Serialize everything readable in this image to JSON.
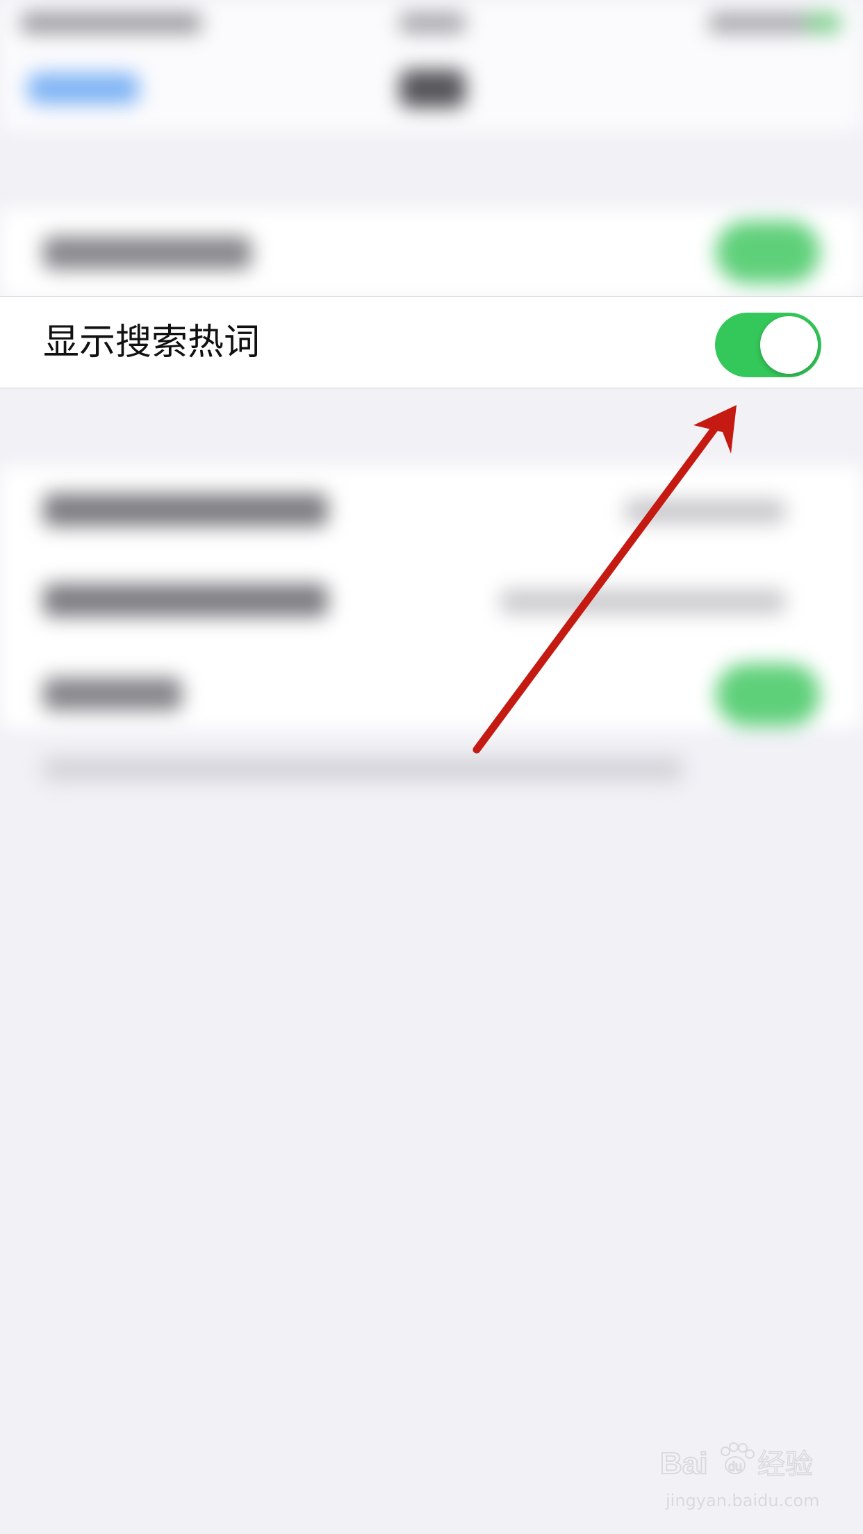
{
  "settings_row": {
    "label": "显示搜索热词",
    "toggle_on": true
  },
  "colors": {
    "toggle_on": "#34c759",
    "background": "#f1f1f6",
    "annotation_arrow": "#c41a12"
  },
  "watermark": {
    "logo_text": "Bai du 经验",
    "sub_text": "jingyan.baidu.com"
  }
}
